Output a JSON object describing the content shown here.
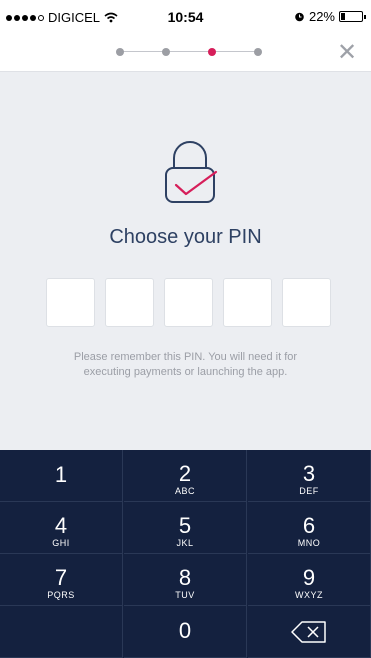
{
  "status_bar": {
    "carrier": "DIGICEL",
    "time": "10:54",
    "battery": "22%",
    "battery_level": 0.22,
    "icons": [
      "signal-icon",
      "wifi-icon",
      "alarm-icon",
      "battery-icon"
    ]
  },
  "header": {
    "steps_total": 4,
    "active_step": 3,
    "close_label": "✕"
  },
  "main": {
    "icon": "lock-check-icon",
    "title": "Choose your PIN",
    "pin_length": 5,
    "hint": "Please remember this PIN. You will need it for executing payments or launching the app."
  },
  "keypad": {
    "keys": [
      {
        "digit": "1",
        "letters": ""
      },
      {
        "digit": "2",
        "letters": "ABC"
      },
      {
        "digit": "3",
        "letters": "DEF"
      },
      {
        "digit": "4",
        "letters": "GHI"
      },
      {
        "digit": "5",
        "letters": "JKL"
      },
      {
        "digit": "6",
        "letters": "MNO"
      },
      {
        "digit": "7",
        "letters": "PQRS"
      },
      {
        "digit": "8",
        "letters": "TUV"
      },
      {
        "digit": "9",
        "letters": "WXYZ"
      },
      {
        "digit": "0",
        "letters": ""
      }
    ],
    "backspace_icon": "backspace-icon"
  },
  "colors": {
    "accent": "#d61e5a",
    "navy": "#14213f",
    "title": "#2e4163",
    "background": "#eceef2"
  }
}
